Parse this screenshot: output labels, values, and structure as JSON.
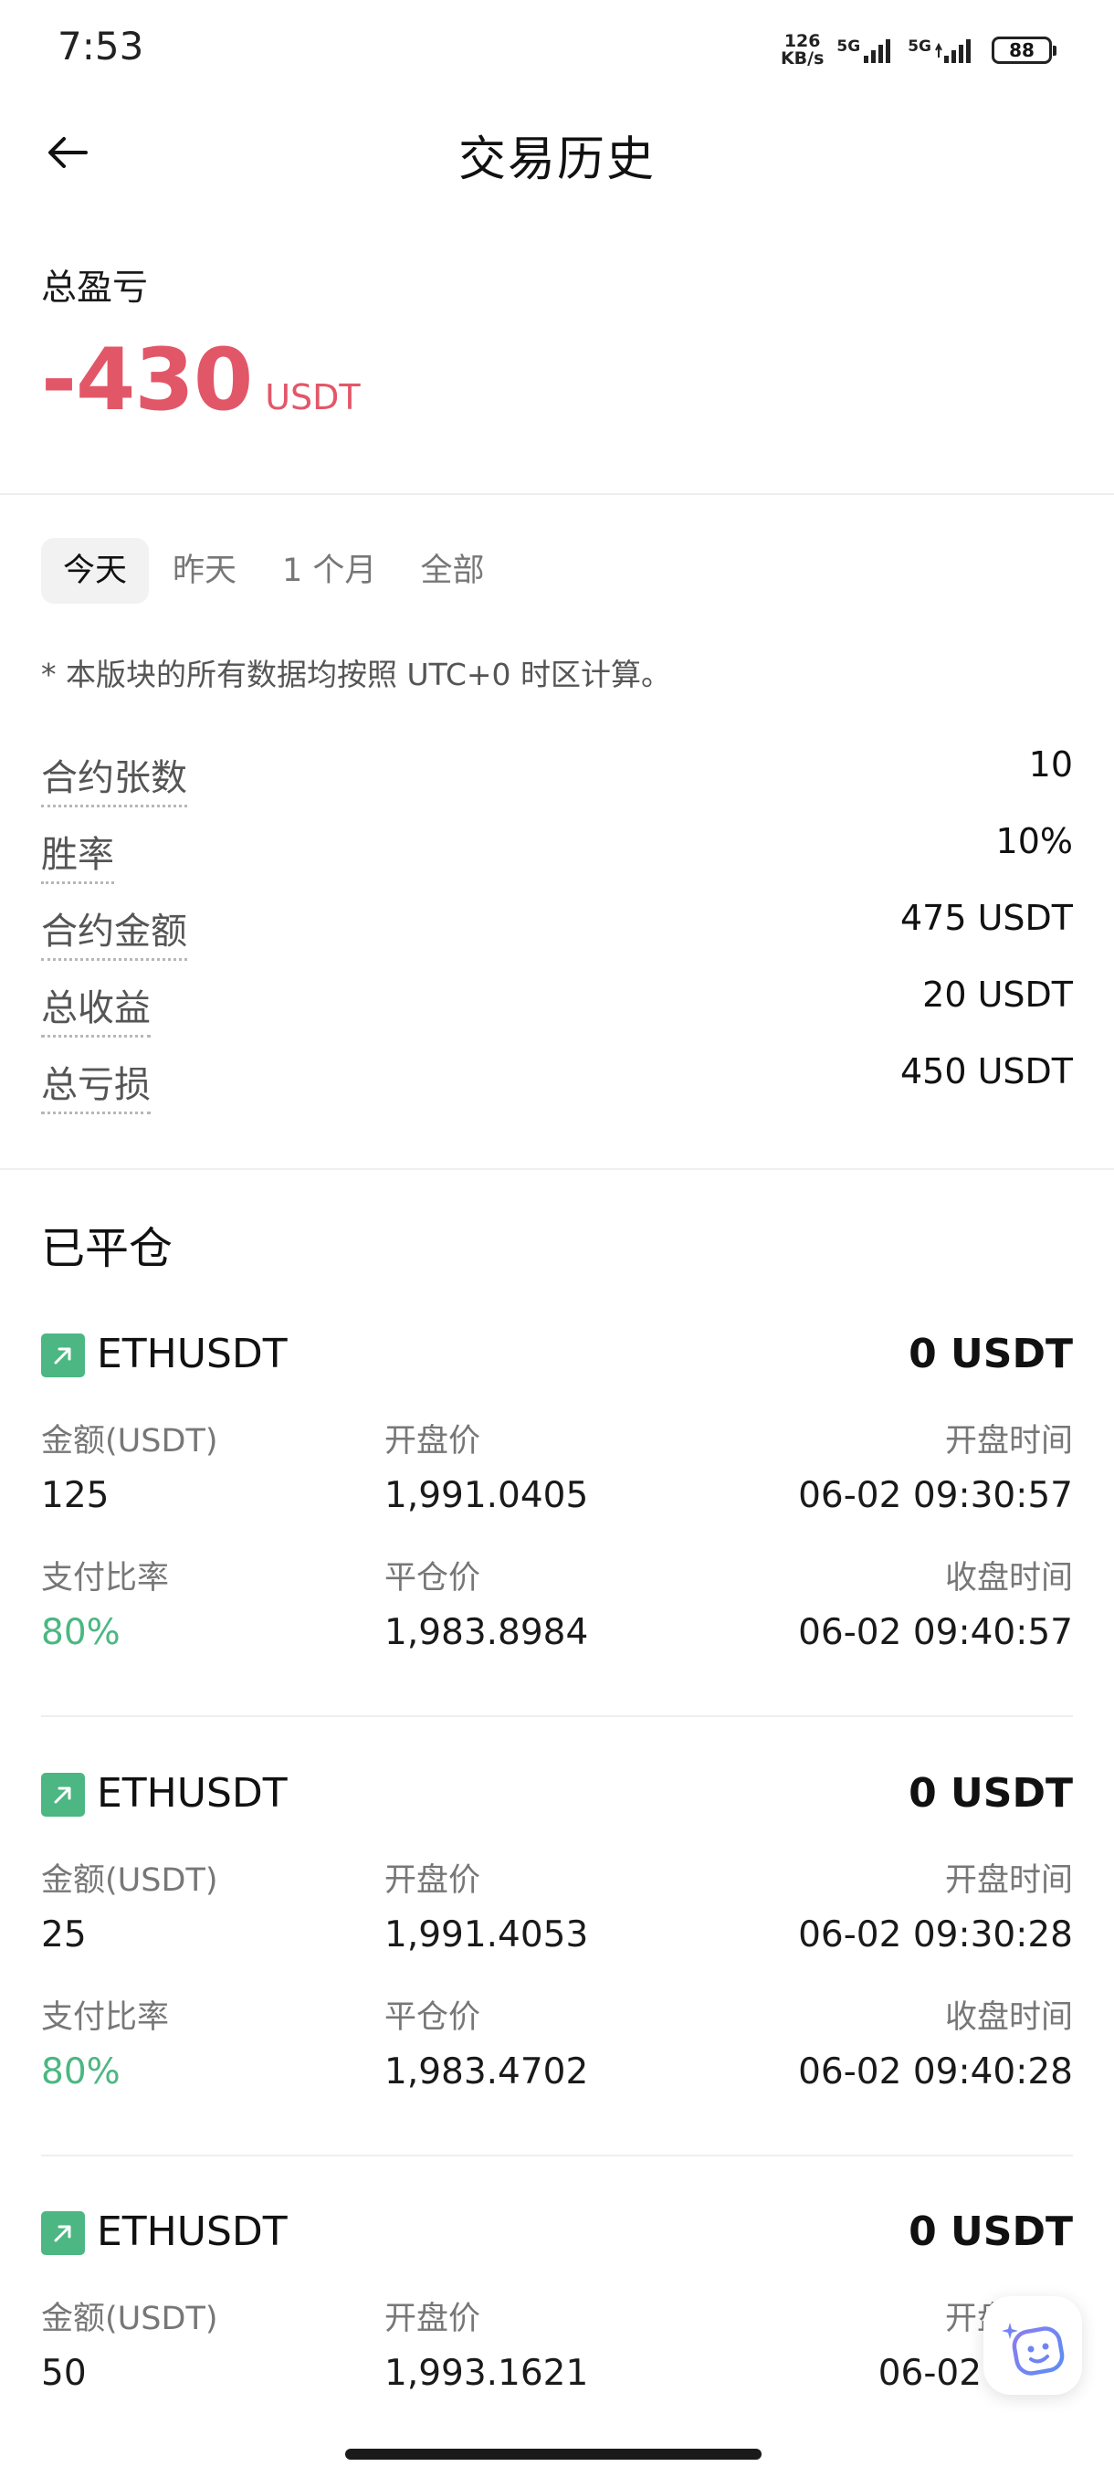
{
  "status_bar": {
    "time": "7:53",
    "net_speed_value": "126",
    "net_speed_unit": "KB/s",
    "signal1_gen": "5G",
    "signal2_gen": "5G",
    "battery": "88"
  },
  "header": {
    "title": "交易历史",
    "back_icon": "arrow-left-icon"
  },
  "pnl": {
    "label": "总盈亏",
    "value": "-430",
    "unit": "USDT",
    "color": "#e25768"
  },
  "tabs": [
    {
      "label": "今天",
      "active": true
    },
    {
      "label": "昨天",
      "active": false
    },
    {
      "label": "1 个月",
      "active": false
    },
    {
      "label": "全部",
      "active": false
    }
  ],
  "note": "* 本版块的所有数据均按照 UTC+0 时区计算。",
  "stats": [
    {
      "label": "合约张数",
      "value": "10"
    },
    {
      "label": "胜率",
      "value": "10%"
    },
    {
      "label": "合约金额",
      "value": "475 USDT"
    },
    {
      "label": "总收益",
      "value": "20 USDT"
    },
    {
      "label": "总亏损",
      "value": "450 USDT"
    }
  ],
  "closed": {
    "title": "已平仓",
    "labels": {
      "amount": "金额(USDT)",
      "open_price": "开盘价",
      "open_time": "开盘时间",
      "payout": "支付比率",
      "close_price": "平仓价",
      "close_time": "收盘时间"
    },
    "trades": [
      {
        "symbol": "ETHUSDT",
        "pnl": "0 USDT",
        "amount": "125",
        "open_price": "1,991.0405",
        "open_time": "06-02 09:30:57",
        "payout": "80%",
        "close_price": "1,983.8984",
        "close_time": "06-02 09:40:57"
      },
      {
        "symbol": "ETHUSDT",
        "pnl": "0 USDT",
        "amount": "25",
        "open_price": "1,991.4053",
        "open_time": "06-02 09:30:28",
        "payout": "80%",
        "close_price": "1,983.4702",
        "close_time": "06-02 09:40:28"
      },
      {
        "symbol": "ETHUSDT",
        "pnl": "0 USDT",
        "amount": "50",
        "open_price": "1,993.1621",
        "open_time": "06-02 09:3"
      }
    ]
  },
  "colors": {
    "accent_green": "#4cb782",
    "loss_red": "#e25768"
  }
}
